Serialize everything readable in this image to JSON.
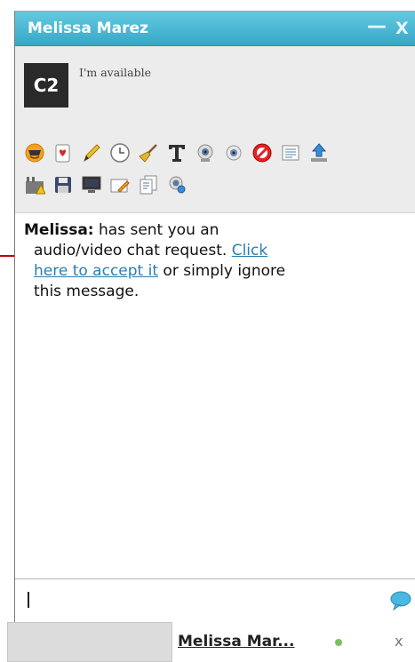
{
  "window": {
    "title": "Melissa Marez",
    "minimize_symbol": "—",
    "close_symbol": "X"
  },
  "contact": {
    "avatar_text": "C2",
    "status": "I'm available"
  },
  "toolbar": {
    "row1": [
      "smiley-icon",
      "card-icon",
      "pencil-icon",
      "clock-icon",
      "broom-icon",
      "text-format-icon",
      "webcam-icon",
      "block-icon",
      "list-icon",
      "upload-icon"
    ],
    "row2": [
      "factory-warning-icon",
      "save-icon",
      "monitor-icon",
      "edit-note-icon",
      "document-icon",
      "webcam-search-icon"
    ]
  },
  "message": {
    "sender": "Melissa:",
    "text_1": " has sent you an",
    "text_2": "audio/video chat request. ",
    "link_1": "Click",
    "link_2": "here to accept it",
    "text_3": " or simply ignore",
    "text_4": "this message."
  },
  "input": {
    "value": ""
  },
  "tabs": {
    "active_name": "Melissa Mar...",
    "close_symbol": "x"
  },
  "colors": {
    "title_bar": "#45b7d6",
    "link": "#2a7fb0",
    "online": "#7cbf5a",
    "annotation_arrow": "#c00000"
  }
}
